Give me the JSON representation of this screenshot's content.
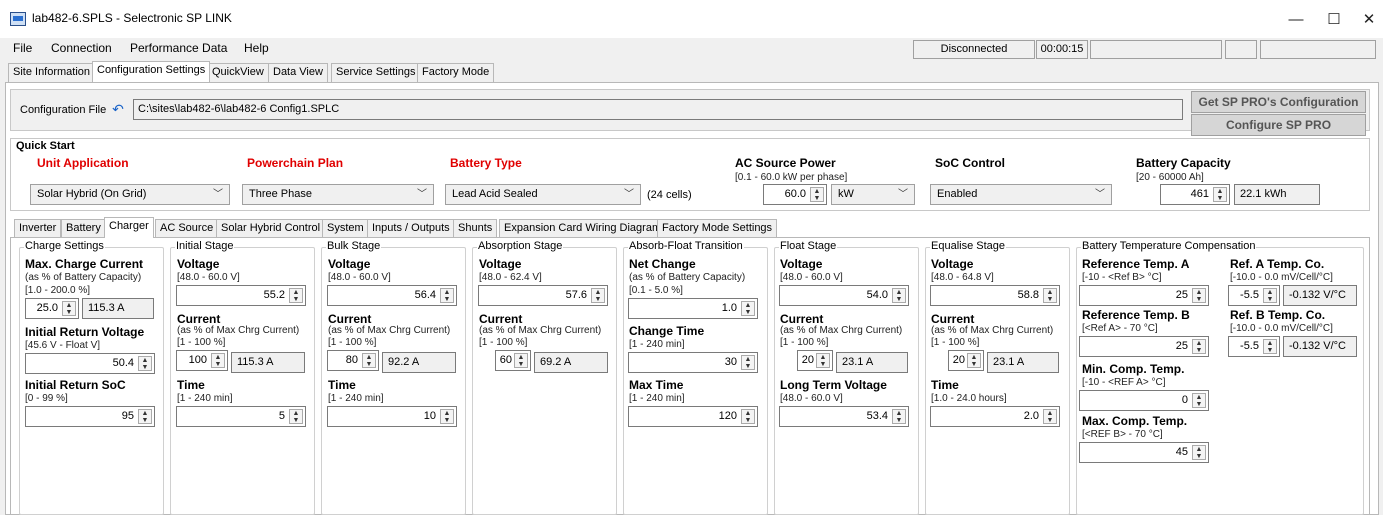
{
  "window": {
    "title": "lab482-6.SPLS - Selectronic SP LINK",
    "minimize": "—",
    "maximize": "☐",
    "close": "✕"
  },
  "menu": [
    "File",
    "Connection",
    "Performance Data",
    "Help"
  ],
  "status": {
    "connection": "Disconnected",
    "timer": "00:00:15"
  },
  "tabs": [
    "Site Information",
    "Configuration Settings",
    "QuickView",
    "Data View",
    "Service Settings",
    "Factory Mode"
  ],
  "config": {
    "label": "Configuration File",
    "path": "C:\\sites\\lab482-6\\lab482-6 Config1.SPLC",
    "get_button": "Get SP PRO's Configuration",
    "configure_button": "Configure SP PRO"
  },
  "quick_start": {
    "title": "Quick Start",
    "unit_application": {
      "label": "Unit Application",
      "value": "Solar Hybrid (On Grid)"
    },
    "powerchain_plan": {
      "label": "Powerchain Plan",
      "value": "Three Phase"
    },
    "battery_type": {
      "label": "Battery Type",
      "value": "Lead Acid Sealed",
      "cells": "(24 cells)"
    },
    "ac_source_power": {
      "label": "AC Source Power",
      "range": "[0.1 - 60.0 kW per phase]",
      "value": "60.0",
      "unit": "kW"
    },
    "soc_control": {
      "label": "SoC Control",
      "value": "Enabled"
    },
    "battery_capacity": {
      "label": "Battery Capacity",
      "range": "[20 - 60000 Ah]",
      "value": "461",
      "kwh": "22.1 kWh"
    }
  },
  "subtabs": [
    "Inverter",
    "Battery",
    "Charger",
    "AC Source",
    "Solar Hybrid Control",
    "System",
    "Inputs / Outputs",
    "Shunts",
    "Expansion Card Wiring Diagram",
    "Factory Mode Settings"
  ],
  "charge_settings": {
    "title": "Charge Settings",
    "max_current_label": "Max. Charge Current",
    "max_current_note": "(as % of Battery Capacity)",
    "max_current_range": "[1.0 - 200.0 %]",
    "max_current_value": "25.0",
    "max_current_amps": "115.3 A",
    "initial_return_voltage_label": "Initial Return Voltage",
    "initial_return_voltage_range": "[45.6 V - Float V]",
    "initial_return_voltage_value": "50.4",
    "initial_return_soc_label": "Initial Return SoC",
    "initial_return_soc_range": "[0 - 99 %]",
    "initial_return_soc_value": "95"
  },
  "initial_stage": {
    "title": "Initial Stage",
    "voltage_label": "Voltage",
    "voltage_range": "[48.0 - 60.0 V]",
    "voltage_value": "55.2",
    "current_label": "Current",
    "current_note": "(as % of Max Chrg Current)",
    "current_range": "[1 - 100 %]",
    "current_value": "100",
    "current_amps": "115.3 A",
    "time_label": "Time",
    "time_range": "[1 - 240 min]",
    "time_value": "5"
  },
  "bulk_stage": {
    "title": "Bulk Stage",
    "voltage_label": "Voltage",
    "voltage_range": "[48.0 - 60.0 V]",
    "voltage_value": "56.4",
    "current_label": "Current",
    "current_note": "(as % of Max Chrg Current)",
    "current_range": "[1 - 100 %]",
    "current_value": "80",
    "current_amps": "92.2 A",
    "time_label": "Time",
    "time_range": "[1 - 240 min]",
    "time_value": "10"
  },
  "absorption_stage": {
    "title": "Absorption Stage",
    "voltage_label": "Voltage",
    "voltage_range": "[48.0 - 62.4 V]",
    "voltage_value": "57.6",
    "current_label": "Current",
    "current_note": "(as % of Max Chrg Current)",
    "current_range": "[1 - 100 %]",
    "current_value": "60",
    "current_amps": "69.2 A"
  },
  "absorb_float": {
    "title": "Absorb-Float Transition",
    "net_change_label": "Net Change",
    "net_change_note": "(as % of Battery Capacity)",
    "net_change_range": "[0.1 - 5.0 %]",
    "net_change_value": "1.0",
    "change_time_label": "Change Time",
    "change_time_range": "[1 - 240 min]",
    "change_time_value": "30",
    "max_time_label": "Max Time",
    "max_time_range": "[1 - 240 min]",
    "max_time_value": "120"
  },
  "float_stage": {
    "title": "Float Stage",
    "voltage_label": "Voltage",
    "voltage_range": "[48.0 - 60.0 V]",
    "voltage_value": "54.0",
    "current_label": "Current",
    "current_note": "(as % of Max Chrg Current)",
    "current_range": "[1 - 100 %]",
    "current_value": "20",
    "current_amps": "23.1 A",
    "ltv_label": "Long Term Voltage",
    "ltv_range": "[48.0 - 60.0 V]",
    "ltv_value": "53.4"
  },
  "equalise_stage": {
    "title": "Equalise Stage",
    "voltage_label": "Voltage",
    "voltage_range": "[48.0 - 64.8 V]",
    "voltage_value": "58.8",
    "current_label": "Current",
    "current_note": "(as % of Max Chrg Current)",
    "current_range": "[1 - 100 %]",
    "current_value": "20",
    "current_amps": "23.1 A",
    "time_label": "Time",
    "time_range": "[1.0 - 24.0 hours]",
    "time_value": "2.0"
  },
  "temp_comp": {
    "title": "Battery Temperature Compensation",
    "ref_a_label": "Reference Temp. A",
    "ref_a_range": "[-10 - <Ref B> °C]",
    "ref_a_value": "25",
    "ref_b_label": "Reference Temp. B",
    "ref_b_range": "[<Ref A> - 70 °C]",
    "ref_b_value": "25",
    "min_label": "Min. Comp. Temp.",
    "min_range": "[-10 - <REF A> °C]",
    "min_value": "0",
    "max_label": "Max. Comp. Temp.",
    "max_range": "[<REF B> - 70 °C]",
    "max_value": "45",
    "coa_label": "Ref. A Temp. Co.",
    "coa_range": "[-10.0 - 0.0 mV/Cell/°C]",
    "coa_value": "-5.5",
    "coa_v": "-0.132 V/°C",
    "cob_label": "Ref. B Temp. Co.",
    "cob_range": "[-10.0 - 0.0 mV/Cell/°C]",
    "cob_value": "-5.5",
    "cob_v": "-0.132 V/°C"
  }
}
